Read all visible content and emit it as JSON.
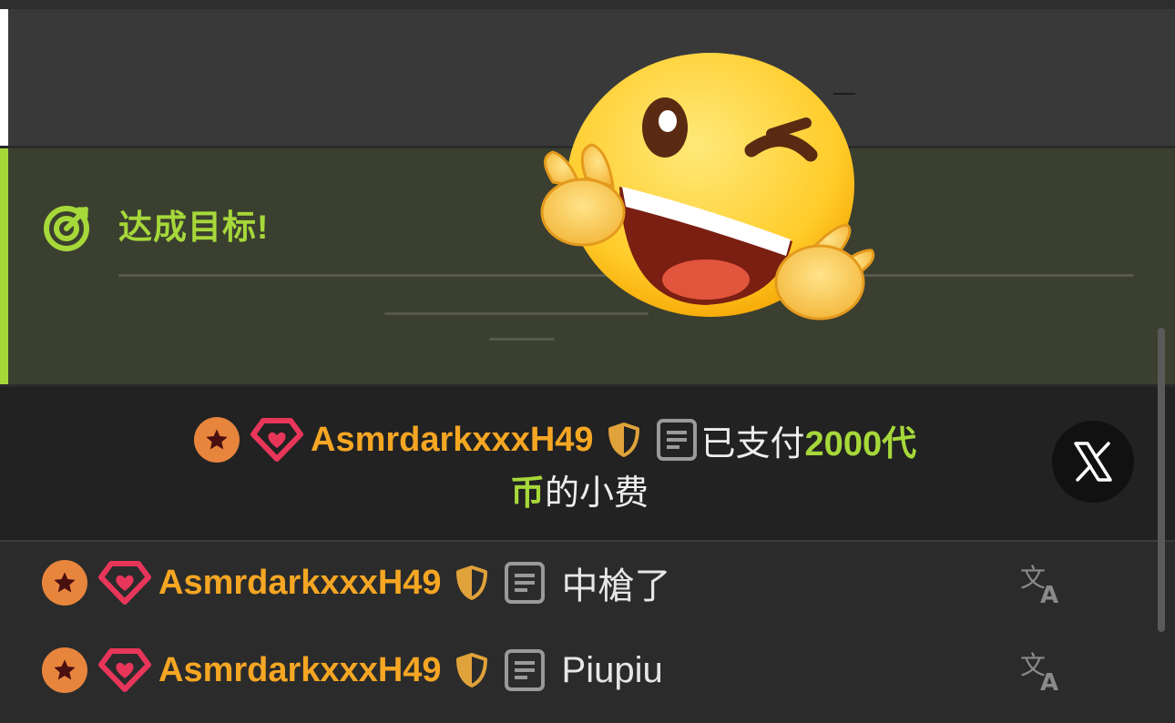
{
  "goal": {
    "title": "达成目标!"
  },
  "tip": {
    "username": "AsmrdarkxxxH49",
    "text_before": "已支付",
    "amount_part1": "2000代",
    "amount_part2": "币",
    "text_after": "的小费"
  },
  "messages": [
    {
      "username": "AsmrdarkxxxH49",
      "text": "中槍了"
    },
    {
      "username": "AsmrdarkxxxH49",
      "text": "Piupiu"
    }
  ],
  "colors": {
    "accent": "#a6d83a",
    "username": "#f5a623",
    "badge_star": "#e8853d",
    "badge_gem": "#e8365a"
  },
  "icons": {
    "goal": "target-icon",
    "close": "x-logo-icon",
    "translate": "translate-icon",
    "badge1": "star-badge-icon",
    "badge2": "diamond-heart-icon",
    "shield": "shield-icon",
    "doc": "document-icon"
  }
}
